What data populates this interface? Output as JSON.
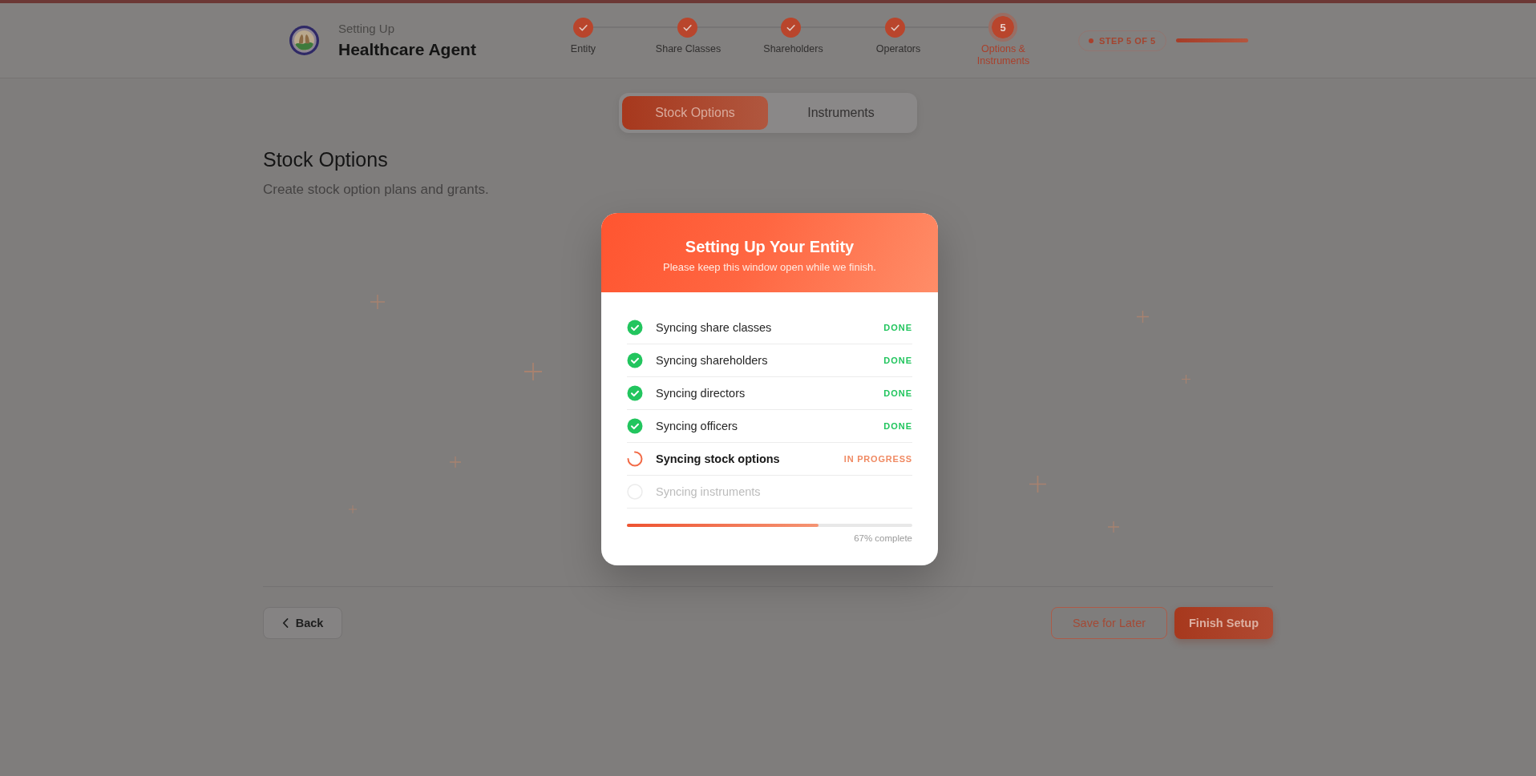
{
  "header": {
    "eyebrow": "Setting Up",
    "title": "Healthcare Agent"
  },
  "stepper": {
    "steps": [
      {
        "label": "Entity",
        "completed": true,
        "selected": false
      },
      {
        "label": "Share Classes",
        "completed": true,
        "selected": false
      },
      {
        "label": "Shareholders",
        "completed": true,
        "selected": false
      },
      {
        "label": "Operators",
        "completed": true,
        "selected": false
      },
      {
        "label": "Options & Instruments",
        "number": "5",
        "completed": false,
        "selected": true
      }
    ],
    "step_badge": "STEP 5 OF 5",
    "progress": {
      "level": 1
    }
  },
  "tabs": [
    {
      "label": "Stock Options",
      "selected": true
    },
    {
      "label": "Instruments",
      "selected": false
    }
  ],
  "section": {
    "title": "Stock Options",
    "description": "Create stock option plans and grants."
  },
  "footer": {
    "back": "Back",
    "actions": [
      {
        "label": "Save for Later",
        "kind": "outline"
      },
      {
        "label": "Finish Setup",
        "kind": "primary"
      }
    ]
  },
  "modal": {
    "title": "Setting Up Your Entity",
    "subtitle": "Please keep this window open while we finish.",
    "tasks": [
      {
        "label": "Syncing share classes",
        "kind": "done",
        "status": "DONE"
      },
      {
        "label": "Syncing shareholders",
        "kind": "done",
        "status": "DONE"
      },
      {
        "label": "Syncing directors",
        "kind": "done",
        "status": "DONE"
      },
      {
        "label": "Syncing officers",
        "kind": "done",
        "status": "DONE"
      },
      {
        "label": "Syncing stock options",
        "kind": "in_progress",
        "status": "IN PROGRESS"
      },
      {
        "label": "Syncing instruments",
        "kind": "pending"
      }
    ],
    "progress": {
      "level": 0.67,
      "label": "67% complete"
    }
  }
}
